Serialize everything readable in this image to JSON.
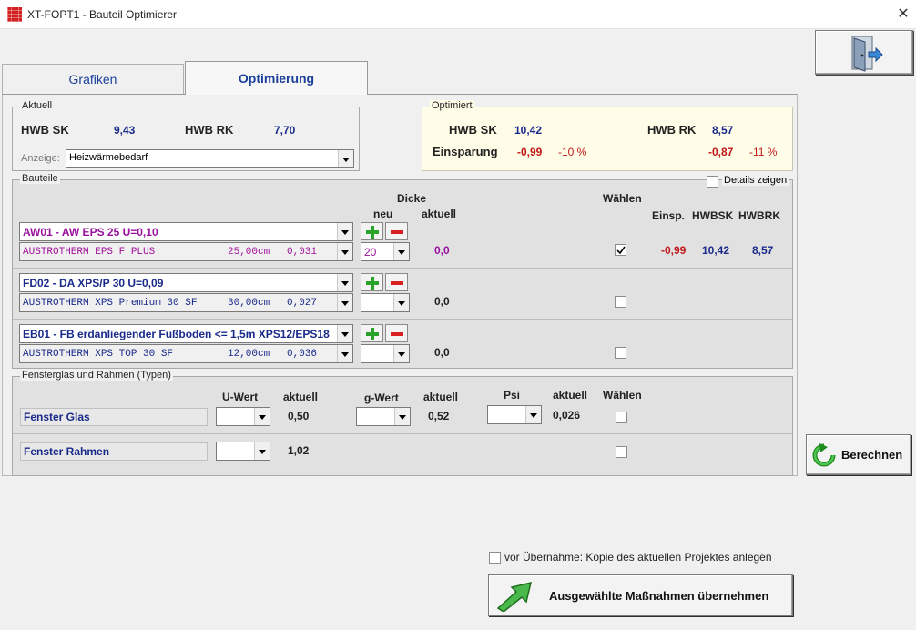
{
  "window": {
    "title": "XT-FOPT1 - Bauteil Optimierer",
    "close": "✕"
  },
  "tabs": [
    {
      "label": "Grafiken"
    },
    {
      "label": "Optimierung"
    }
  ],
  "aktuell": {
    "legend": "Aktuell",
    "hwb_sk_label": "HWB SK",
    "hwb_sk_value": "9,43",
    "hwb_rk_label": "HWB RK",
    "hwb_rk_value": "7,70",
    "anzeige_label": "Anzeige:",
    "anzeige_value": "Heizwärmebedarf"
  },
  "optimiert": {
    "legend": "Optimiert",
    "hwb_sk_label": "HWB SK",
    "hwb_sk_value": "10,42",
    "hwb_rk_label": "HWB RK",
    "hwb_rk_value": "8,57",
    "einsparung_label": "Einsparung",
    "sk_diff": "-0,99",
    "sk_pct": "-10 %",
    "rk_diff": "-0,87",
    "rk_pct": "-11 %"
  },
  "bauteile": {
    "legend": "Bauteile",
    "details_label": "Details zeigen",
    "headers": {
      "dicke": "Dicke",
      "neu": "neu",
      "aktuell": "aktuell",
      "waehlen": "Wählen",
      "einsp": "Einsp.",
      "hwbsk": "HWBSK",
      "hwbrk": "HWBRK"
    },
    "rows": [
      {
        "name": "AW01 - AW EPS 25 U=0,10",
        "material": "AUSTROTHERM EPS F PLUS",
        "thickness": "25,00cm",
        "lambda": "0,031",
        "neu": "20",
        "aktuell": "0,0",
        "checked": true,
        "einsp": "-0,99",
        "hwbsk": "10,42",
        "hwbrk": "8,57"
      },
      {
        "name": "FD02 - DA XPS/P 30 U=0,09",
        "material": "AUSTROTHERM XPS Premium 30 SF",
        "thickness": "30,00cm",
        "lambda": "0,027",
        "neu": "",
        "aktuell": "0,0",
        "checked": false
      },
      {
        "name": "EB01 - FB  erdanliegender Fußboden <= 1,5m XPS12/EPS18",
        "material": "AUSTROTHERM XPS TOP 30 SF",
        "thickness": "12,00cm",
        "lambda": "0,036",
        "neu": "",
        "aktuell": "0,0",
        "checked": false
      }
    ]
  },
  "fenster": {
    "legend": "Fensterglas und Rahmen  (Typen)",
    "headers": {
      "uwert": "U-Wert",
      "aktuell1": "aktuell",
      "gwert": "g-Wert",
      "aktuell2": "aktuell",
      "psi": "Psi",
      "aktuell3": "aktuell",
      "waehlen": "Wählen"
    },
    "glas": {
      "label": "Fenster Glas",
      "u_aktuell": "0,50",
      "g_aktuell": "0,52",
      "psi_aktuell": "0,026"
    },
    "rahmen": {
      "label": "Fenster Rahmen",
      "u_aktuell": "1,02"
    }
  },
  "buttons": {
    "berechnen": "Berechnen",
    "uebernehmen": "Ausgewählte Maßnahmen übernehmen",
    "kopie_label": "vor Übernahme: Kopie des aktuellen Projektes anlegen"
  }
}
